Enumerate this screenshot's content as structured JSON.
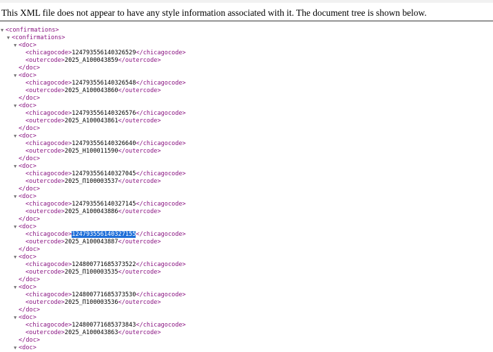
{
  "notice": "This XML file does not appear to have any style information associated with it. The document tree is shown below.",
  "toggle_glyph": "▼",
  "tags": {
    "confirmations_open": "<confirmations>",
    "doc_open": "<doc>",
    "doc_close": "</doc>",
    "chicagocode_open": "<chicagocode>",
    "chicagocode_close": "</chicagocode>",
    "outercode_open": "<outercode>",
    "outercode_close": "</outercode>"
  },
  "docs": [
    {
      "chicagocode": "124793556140326529",
      "outercode": "2025_A100043859"
    },
    {
      "chicagocode": "124793556140326548",
      "outercode": "2025_A100043860"
    },
    {
      "chicagocode": "124793556140326576",
      "outercode": "2025_A100043861"
    },
    {
      "chicagocode": "124793556140326640",
      "outercode": "2025_H100011590"
    },
    {
      "chicagocode": "124793556140327045",
      "outercode": "2025_П100003537"
    },
    {
      "chicagocode": "124793556140327145",
      "outercode": "2025_A100043886"
    },
    {
      "chicagocode": "124793556140327155",
      "outercode": "2025_A100043887",
      "selected": true
    },
    {
      "chicagocode": "124800771685373522",
      "outercode": "2025_П100003535"
    },
    {
      "chicagocode": "124800771685373530",
      "outercode": "2025_П100003536"
    },
    {
      "chicagocode": "124800771685373843",
      "outercode": "2025_A100043863"
    }
  ],
  "colors": {
    "tag": "#881280",
    "text": "#000000",
    "toggle": "#707070",
    "selection": "#1e6ed8"
  }
}
